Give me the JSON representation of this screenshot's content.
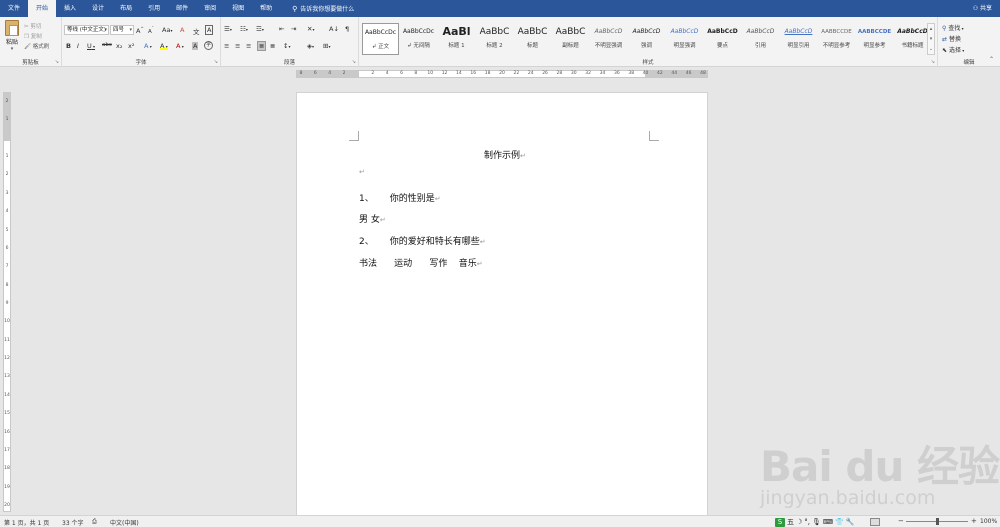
{
  "tabs": [
    "文件",
    "开始",
    "插入",
    "设计",
    "布局",
    "引用",
    "邮件",
    "审阅",
    "视图",
    "帮助"
  ],
  "active_tab": "开始",
  "tell_me": "告诉我你想要做什么",
  "share": "共享",
  "clipboard": {
    "paste": "粘贴",
    "cut": "剪切",
    "copy": "复制",
    "format_painter": "格式刷",
    "label": "剪贴板"
  },
  "font": {
    "name": "等线 (中文正文)",
    "size": "四号",
    "label": "字体",
    "grow": "A",
    "shrink": "A",
    "case": "Aa",
    "clear": "A",
    "phonetic": "文",
    "border_char": "A",
    "bold": "B",
    "italic": "I",
    "underline": "U",
    "strike": "abc",
    "subscript": "x₂",
    "superscript": "x²",
    "effects": "A",
    "highlight": "A",
    "color": "A",
    "shading": "A",
    "enclose": "字"
  },
  "paragraph": {
    "label": "段落",
    "sort": "A↓",
    "marks": "¶"
  },
  "styles": {
    "label": "样式",
    "items": [
      {
        "sample": "AaBbCcDc",
        "name": "正文"
      },
      {
        "sample": "AaBbCcDc",
        "name": "无间隔"
      },
      {
        "sample": "AaBl",
        "name": "标题 1"
      },
      {
        "sample": "AaBbC",
        "name": "标题 2"
      },
      {
        "sample": "AaBbC",
        "name": "标题"
      },
      {
        "sample": "AaBbC",
        "name": "副标题"
      },
      {
        "sample": "AaBbCcD",
        "name": "不明显强调"
      },
      {
        "sample": "AaBbCcD",
        "name": "强调"
      },
      {
        "sample": "AaBbCcD",
        "name": "明显强调"
      },
      {
        "sample": "AaBbCcD",
        "name": "要点"
      },
      {
        "sample": "AaBbCcD",
        "name": "引用"
      },
      {
        "sample": "AaBbCcD",
        "name": "明显引用"
      },
      {
        "sample": "AABBCCDE",
        "name": "不明显参考"
      },
      {
        "sample": "AABBCCDE",
        "name": "明显参考"
      },
      {
        "sample": "AaBbCcD",
        "name": "书籍标题"
      }
    ]
  },
  "editing": {
    "label": "编辑",
    "find": "查找",
    "replace": "替换",
    "select": "选择"
  },
  "ruler": {
    "h_ticks": [
      "8",
      "6",
      "4",
      "2",
      "",
      "2",
      "4",
      "6",
      "8",
      "10",
      "12",
      "14",
      "16",
      "18",
      "20",
      "22",
      "24",
      "26",
      "28",
      "30",
      "32",
      "34",
      "36",
      "38",
      "40",
      "42",
      "44",
      "46",
      "48"
    ],
    "v_ticks": [
      "2",
      "1",
      "",
      "1",
      "2",
      "3",
      "4",
      "5",
      "6",
      "7",
      "8",
      "9",
      "10",
      "11",
      "12",
      "13",
      "14",
      "15",
      "16",
      "17",
      "18",
      "19",
      "20"
    ]
  },
  "document": {
    "title": "制作示例",
    "q1_num": "1、",
    "q1": "你的性别是",
    "q1_options": "男   女",
    "q2_num": "2、",
    "q2": "你的爱好和特长有哪些",
    "q2_options": "书法      运动      写作    音乐",
    "para_mark": "↵"
  },
  "status": {
    "page": "第 1 页，共 1 页",
    "words": "33 个字",
    "language": "中文(中国)",
    "zoom": "100%",
    "ime": "五",
    "ime_logo": "S"
  },
  "watermark": {
    "logo": "Bai du 经验",
    "url": "jingyan.baidu.com"
  },
  "colors": {
    "accent": "#2b579a",
    "ribbon": "#f3f3f3",
    "canvas": "#e6e6e6"
  }
}
